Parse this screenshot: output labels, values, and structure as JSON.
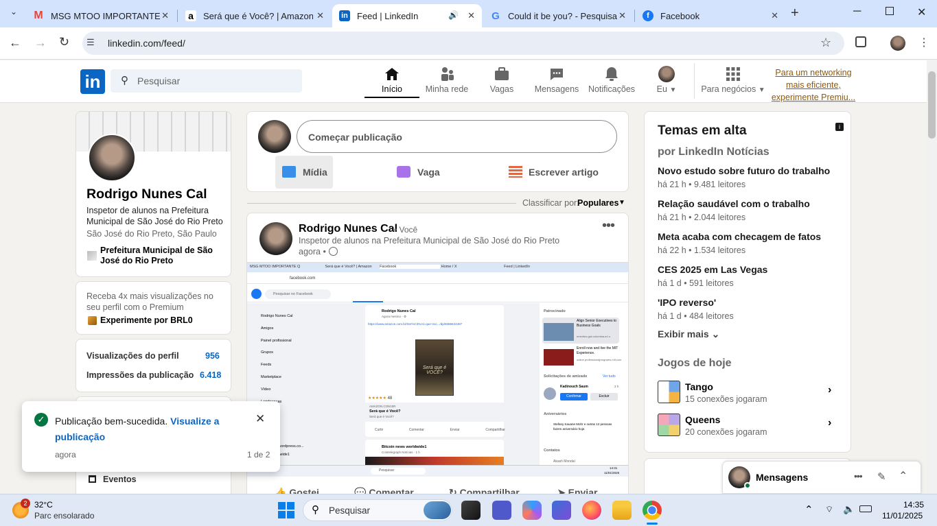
{
  "browser": {
    "tabs": [
      {
        "title": "MSG MTOO IMPORTANTE Q",
        "icon": "gmail-icon"
      },
      {
        "title": "Será que é Você? | Amazon.c",
        "icon": "amazon-icon"
      },
      {
        "title": "Feed | LinkedIn",
        "icon": "linkedin-icon",
        "active": true
      },
      {
        "title": "Could it be you? - Pesquisa",
        "icon": "google-icon"
      },
      {
        "title": "Facebook",
        "icon": "facebook-icon"
      }
    ],
    "url": "linkedin.com/feed/"
  },
  "nav": {
    "search_placeholder": "Pesquisar",
    "items": [
      {
        "label": "Início"
      },
      {
        "label": "Minha rede"
      },
      {
        "label": "Vagas"
      },
      {
        "label": "Mensagens"
      },
      {
        "label": "Notificações"
      },
      {
        "label": "Eu"
      },
      {
        "label": "Para negócios"
      }
    ],
    "promo": [
      "Para um networking",
      "mais eficiente,",
      "experimente Premiu..."
    ]
  },
  "profile": {
    "name": "Rodrigo Nunes Cal",
    "headline": "Inspetor de alunos na Prefeitura Municipal de São José do Rio Preto",
    "location": "São José do Rio Preto, São Paulo",
    "org": "Prefeitura Municipal de São José do Rio Preto",
    "premium_text": "Receba 4x mais visualizações no seu perfil com o Premium",
    "premium_cta": "Experimente por BRL0",
    "stats": [
      {
        "label": "Visualizações do perfil",
        "value": "956"
      },
      {
        "label": "Impressões da publicação",
        "value": "6.418"
      }
    ],
    "events": "Eventos"
  },
  "composer": {
    "placeholder": "Começar publicação",
    "actions": [
      "Mídia",
      "Vaga",
      "Escrever artigo"
    ]
  },
  "sort": {
    "label": "Classificar por:",
    "value": "Populares"
  },
  "post": {
    "author": "Rodrigo Nunes Cal",
    "badge": "• Você",
    "headline": "Inspetor de alunos na Prefeitura Municipal de São José do Rio Preto",
    "time": "agora •",
    "actions": [
      "Gostei",
      "Comentar",
      "Compartilhar",
      "Enviar"
    ]
  },
  "shot": {
    "url": "facebook.com",
    "search": "Pesquisar no Facebook",
    "menu": [
      "Rodrigo Nunes Cal",
      "Amigos",
      "Painel profissional",
      "Grupos",
      "Feeds",
      "Marketplace",
      "Vídeo",
      "Lembranças"
    ],
    "post_author": "Rodrigo Nunes Cal",
    "post_time": "Agora mesmo · ⚙",
    "post_link": "https://www.amazon.com.br/Ser%C3%A1-que-Voc.../dp/6586624487",
    "book_title": "Será que é VOCÊ?",
    "rating": "48",
    "domain": "AMAZON.COM.BR",
    "link_title": "Será que é Você?",
    "link_sub": "Será que é Você?",
    "post_actions": [
      "Curtir",
      "Comentar",
      "Enviar",
      "Compartilhar"
    ],
    "next_author": "Bitcoin news worldwide1",
    "next_sub": "Cointelegraph Notícias · 1 h",
    "sponsored": "Patrocinado",
    "ad1": "Align Senior Executives to Business Goals",
    "ad1_domain": "emeritus.gsb.columbia.ed u",
    "ad2": "Enroll now and live the MIT Experience.",
    "ad2_domain": "online.professionalprograms.mit.com",
    "friend_req": "Solicitações de amizade",
    "see_all": "Ver tudo",
    "friend_name": "Kadinouch Saum",
    "friend_time": "3 h",
    "confirm": "Confirmar",
    "delete": "Excluir",
    "birthdays": "Aniversários",
    "birthday_text": "Stefany Kauane Mohr e outras 12 pessoas fazem aniversário hoje.",
    "contacts": "Contatos",
    "contact1": "Akash Mondal",
    "blog": "blog",
    "blog2": "voce1984.wordpress.co...",
    "blog3": "news worldwide1",
    "tabs": [
      "MSG MTOO IMPORTANTE Q",
      "Será que é Você? | Amazon",
      "Facebook",
      "Home / X",
      "Feed | LinkedIn"
    ],
    "clock": "14:31",
    "date": "11/01/2025",
    "taskbar_search": "Pesquisar"
  },
  "trending": {
    "title": "Temas em alta",
    "subtitle": "por LinkedIn Notícias",
    "items": [
      {
        "title": "Novo estudo sobre futuro do trabalho",
        "meta": "há 21 h • 9.481 leitores"
      },
      {
        "title": "Relação saudável com o trabalho",
        "meta": "há 21 h • 2.044 leitores"
      },
      {
        "title": "Meta acaba com checagem de fatos",
        "meta": "há 22 h • 1.534 leitores"
      },
      {
        "title": "CES 2025 em Las Vegas",
        "meta": "há 1 d • 591 leitores"
      },
      {
        "title": "'IPO reverso'",
        "meta": "há 1 d • 484 leitores"
      }
    ],
    "more": "Exibir mais",
    "games_title": "Jogos de hoje",
    "games": [
      {
        "name": "Tango",
        "meta": "15 conexões jogaram"
      },
      {
        "name": "Queens",
        "meta": "20 conexões jogaram"
      }
    ]
  },
  "messaging": {
    "label": "Mensagens"
  },
  "toast": {
    "text": "Publicação bem-sucedida.",
    "link": "Visualize a publicação",
    "time": "agora",
    "count": "1 de 2"
  },
  "taskbar": {
    "weather_temp": "32°C",
    "weather_desc": "Parc ensolarado",
    "weather_badge": "2",
    "search": "Pesquisar",
    "time": "14:35",
    "date": "11/01/2025"
  },
  "colors": {
    "brand": "#0a66c2",
    "success": "#057642",
    "tabbar": "#d3e3fd"
  }
}
